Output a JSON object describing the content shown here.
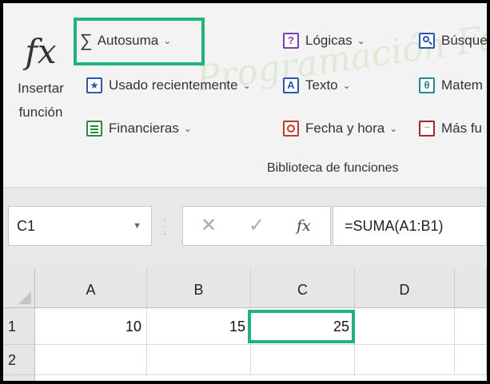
{
  "ribbon": {
    "insert_function": {
      "line1": "Insertar",
      "line2": "función"
    },
    "autosum": {
      "label": "Autosuma"
    },
    "recently_used": {
      "label": "Usado recientemente"
    },
    "financial": {
      "label": "Financieras"
    },
    "logical": {
      "label": "Lógicas"
    },
    "text": {
      "label": "Texto",
      "icon_glyph": "A"
    },
    "date_time": {
      "label": "Fecha y hora"
    },
    "lookup": {
      "label": "Búsque"
    },
    "math": {
      "label": "Matem"
    },
    "more": {
      "label": "Más fu"
    },
    "group_label": "Biblioteca de funciones",
    "watermark": "Programación Fácil"
  },
  "formula_bar": {
    "name_box": "C1",
    "formula": "=SUMA(A1:B1)"
  },
  "grid": {
    "columns": [
      "A",
      "B",
      "C",
      "D"
    ],
    "rows": [
      "1",
      "2"
    ],
    "cells": {
      "A1": "10",
      "B1": "15",
      "C1": "25"
    },
    "selected_cell": "C1"
  },
  "colors": {
    "highlight": "#1fb57a",
    "ribbon_bg": "#f3f3f3",
    "header_bg": "#e6e6e6"
  },
  "icons": {
    "insert_function": "fx-icon",
    "autosum": "sigma-icon",
    "recently_used": "star-book-icon",
    "financial": "financial-book-icon",
    "logical": "question-book-icon",
    "text": "text-book-icon",
    "date_time": "clock-book-icon",
    "lookup": "search-book-icon",
    "math": "theta-book-icon",
    "more": "more-book-icon"
  }
}
